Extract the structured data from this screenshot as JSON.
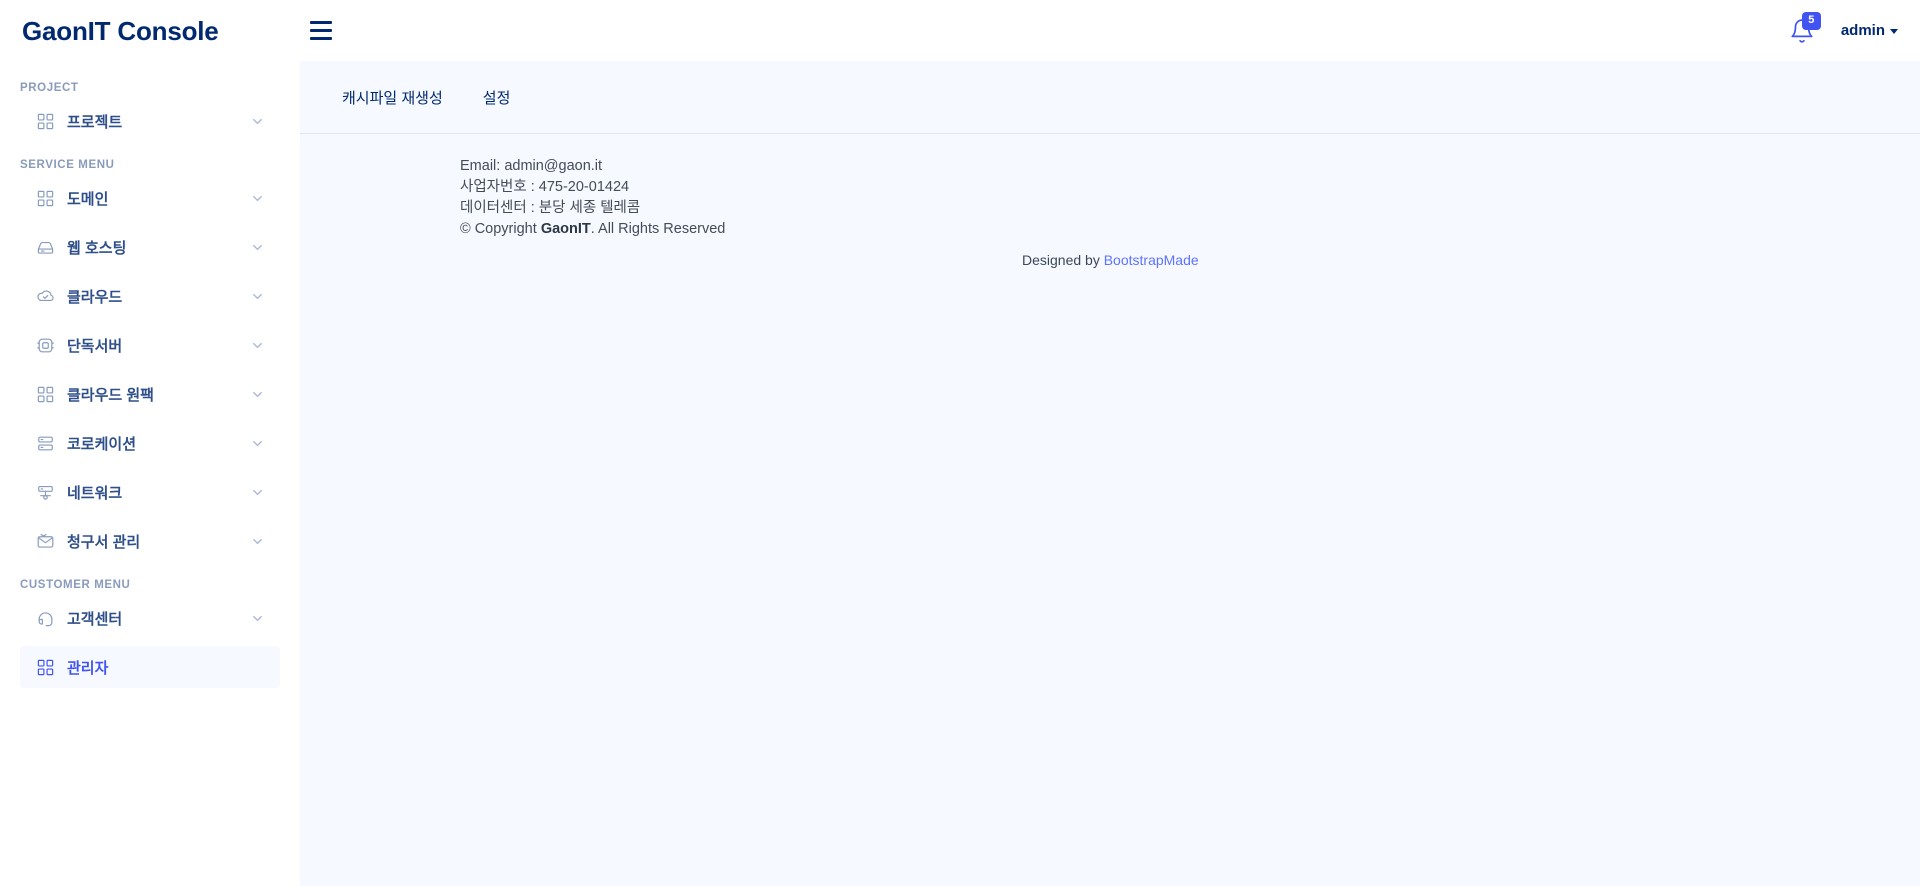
{
  "header": {
    "logo": "GaonIT Console",
    "menu_toggle_label": "Toggle sidebar",
    "notification_count": "5",
    "profile_name": "admin"
  },
  "sidebar": {
    "sections": [
      {
        "heading": "PROJECT",
        "items": [
          {
            "label": "프로젝트",
            "icon": "grid-icon",
            "expandable": true,
            "active": false
          }
        ]
      },
      {
        "heading": "SERVICE MENU",
        "items": [
          {
            "label": "도메인",
            "icon": "grid-icon",
            "expandable": true,
            "active": false
          },
          {
            "label": "웹 호스팅",
            "icon": "hosting-icon",
            "expandable": true,
            "active": false
          },
          {
            "label": "클라우드",
            "icon": "cloud-icon",
            "expandable": true,
            "active": false
          },
          {
            "label": "단독서버",
            "icon": "server-chip-icon",
            "expandable": true,
            "active": false
          },
          {
            "label": "클라우드 원팩",
            "icon": "grid-icon",
            "expandable": true,
            "active": false
          },
          {
            "label": "코로케이션",
            "icon": "rack-icon",
            "expandable": true,
            "active": false
          },
          {
            "label": "네트워크",
            "icon": "network-icon",
            "expandable": true,
            "active": false
          },
          {
            "label": "청구서 관리",
            "icon": "invoice-mail-icon",
            "expandable": true,
            "active": false
          }
        ]
      },
      {
        "heading": "CUSTOMER MENU",
        "items": [
          {
            "label": "고객센터",
            "icon": "headset-icon",
            "expandable": true,
            "active": false
          },
          {
            "label": "관리자",
            "icon": "grid-icon",
            "expandable": false,
            "active": true
          }
        ]
      }
    ]
  },
  "main": {
    "tabs": [
      {
        "label": "캐시파일 재생성"
      },
      {
        "label": "설정"
      }
    ],
    "footer": {
      "email_line": "Email: admin@gaon.it",
      "business_no_line": "사업자번호 : 475-20-01424",
      "datacenter_line": "데이터센터 : 분당 세종 텔레콤",
      "copyright_prefix": "© Copyright ",
      "copyright_brand": "GaonIT",
      "copyright_suffix": ". All Rights Reserved",
      "credits_prefix": "Designed by ",
      "credits_link": "BootstrapMade"
    }
  },
  "colors": {
    "brand_navy": "#012970",
    "accent_blue": "#4154f1",
    "content_bg": "#f6f9ff",
    "muted": "#899bbd"
  }
}
